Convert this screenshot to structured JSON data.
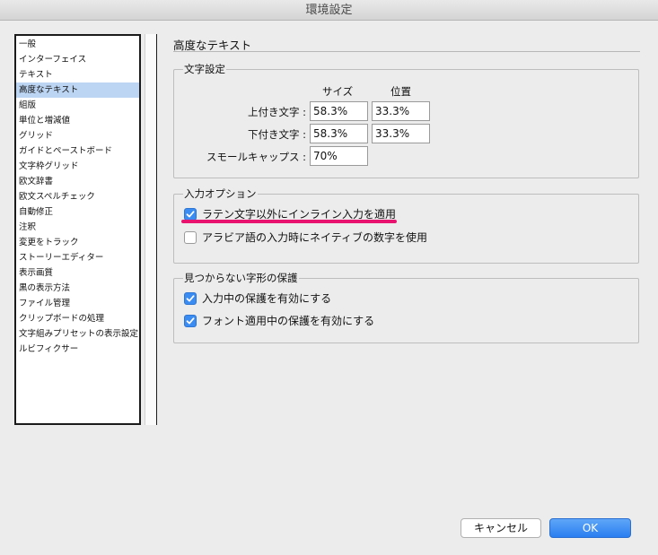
{
  "window": {
    "title": "環境設定"
  },
  "sidebar": {
    "items": [
      {
        "label": "一般"
      },
      {
        "label": "インターフェイス"
      },
      {
        "label": "テキスト"
      },
      {
        "label": "高度なテキスト",
        "selected": true
      },
      {
        "label": "組版"
      },
      {
        "label": "単位と増減値"
      },
      {
        "label": "グリッド"
      },
      {
        "label": "ガイドとペーストボード"
      },
      {
        "label": "文字枠グリッド"
      },
      {
        "label": "欧文辞書"
      },
      {
        "label": "欧文スペルチェック"
      },
      {
        "label": "自動修正"
      },
      {
        "label": "注釈"
      },
      {
        "label": "変更をトラック"
      },
      {
        "label": "ストーリーエディター"
      },
      {
        "label": "表示画質"
      },
      {
        "label": "黒の表示方法"
      },
      {
        "label": "ファイル管理"
      },
      {
        "label": "クリップボードの処理"
      },
      {
        "label": "文字組みプリセットの表示設定"
      },
      {
        "label": "ルビフィクサー"
      }
    ]
  },
  "page": {
    "title": "高度なテキスト"
  },
  "char_settings": {
    "title": "文字設定",
    "col_size": "サイズ",
    "col_position": "位置",
    "superscript": {
      "label": "上付き文字 :",
      "size": "58.3%",
      "position": "33.3%"
    },
    "subscript": {
      "label": "下付き文字 :",
      "size": "58.3%",
      "position": "33.3%"
    },
    "small_caps": {
      "label": "スモールキャップス :",
      "size": "70%"
    }
  },
  "input_options": {
    "title": "入力オプション",
    "inline_input": {
      "label": "ラテン文字以外にインライン入力を適用",
      "checked": true
    },
    "native_digits": {
      "label": "アラビア語の入力時にネイティブの数字を使用",
      "checked": false
    }
  },
  "missing_glyph": {
    "title": "見つからない字形の保護",
    "protect_typing": {
      "label": "入力中の保護を有効にする",
      "checked": true
    },
    "protect_font": {
      "label": "フォント適用中の保護を有効にする",
      "checked": true
    }
  },
  "buttons": {
    "cancel": "キャンセル",
    "ok": "OK"
  },
  "colors": {
    "accent": "#3a8bf2",
    "highlight_underline": "#e8136f",
    "selection": "#bcd5f3"
  }
}
